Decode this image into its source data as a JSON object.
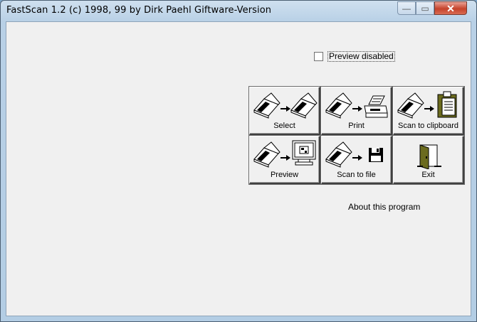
{
  "window": {
    "title": "FastScan 1.2 (c) 1998, 99 by Dirk Paehl  Giftware-Version",
    "controls": {
      "minimize": "—",
      "maximize": "▭",
      "close": "✕"
    }
  },
  "preview_checkbox": {
    "label": "Preview disabled",
    "checked": false
  },
  "buttons": {
    "select": {
      "label": "Select",
      "icon": "scanner-to-scanner-icon"
    },
    "print": {
      "label": "Print",
      "icon": "scanner-to-printer-icon"
    },
    "clipboard": {
      "label": "Scan to clipboard",
      "icon": "scanner-to-clipboard-icon"
    },
    "preview": {
      "label": "Preview",
      "icon": "scanner-to-monitor-icon"
    },
    "file": {
      "label": "Scan to file",
      "icon": "scanner-to-floppy-icon"
    },
    "exit": {
      "label": "Exit",
      "icon": "exit-door-icon"
    }
  },
  "about": {
    "label": "About this program"
  }
}
